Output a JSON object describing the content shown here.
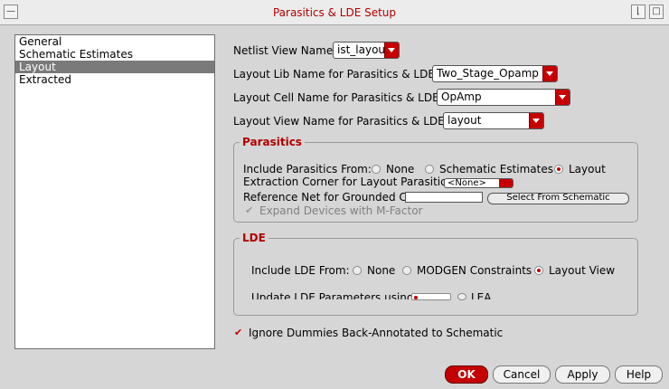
{
  "window": {
    "title": "Parasitics & LDE Setup"
  },
  "sidebar": {
    "items": [
      "General",
      "Schematic Estimates",
      "Layout",
      "Extracted"
    ],
    "selected_index": 2
  },
  "form": {
    "netlist_view_label": "Netlist View Name:",
    "netlist_view_value": "ist_layout",
    "layout_lib_label": "Layout Lib Name for Parasitics & LDE:",
    "layout_lib_value": "Two_Stage_Opamp",
    "layout_cell_label": "Layout Cell Name for Parasitics & LDE:",
    "layout_cell_value": "OpAmp",
    "layout_view_label": "Layout View Name for Parasitics & LDE:",
    "layout_view_value": "layout"
  },
  "parasitics": {
    "title": "Parasitics",
    "include_label": "Include Parasitics From:",
    "opt_none": "None",
    "opt_schematic": "Schematic Estimates",
    "opt_layout": "Layout",
    "corner_label": "Extraction Corner for Layout Parasitics:",
    "corner_value": "<None>",
    "refnet_label": "Reference Net for Grounded C:",
    "refnet_button": "Select From Schematic",
    "expand_label": "Expand Devices with M-Factor"
  },
  "lde": {
    "title": "LDE",
    "include_label": "Include LDE From:",
    "opt_none": "None",
    "opt_modgen": "MODGEN Constraints",
    "opt_layout": "Layout View",
    "update_label": "Update LDE Parameters using:",
    "update_opt_lea": "LEA"
  },
  "ignore_dummies_label": "Ignore Dummies Back-Annotated to Schematic",
  "buttons": {
    "ok": "OK",
    "cancel": "Cancel",
    "apply": "Apply",
    "help": "Help"
  }
}
